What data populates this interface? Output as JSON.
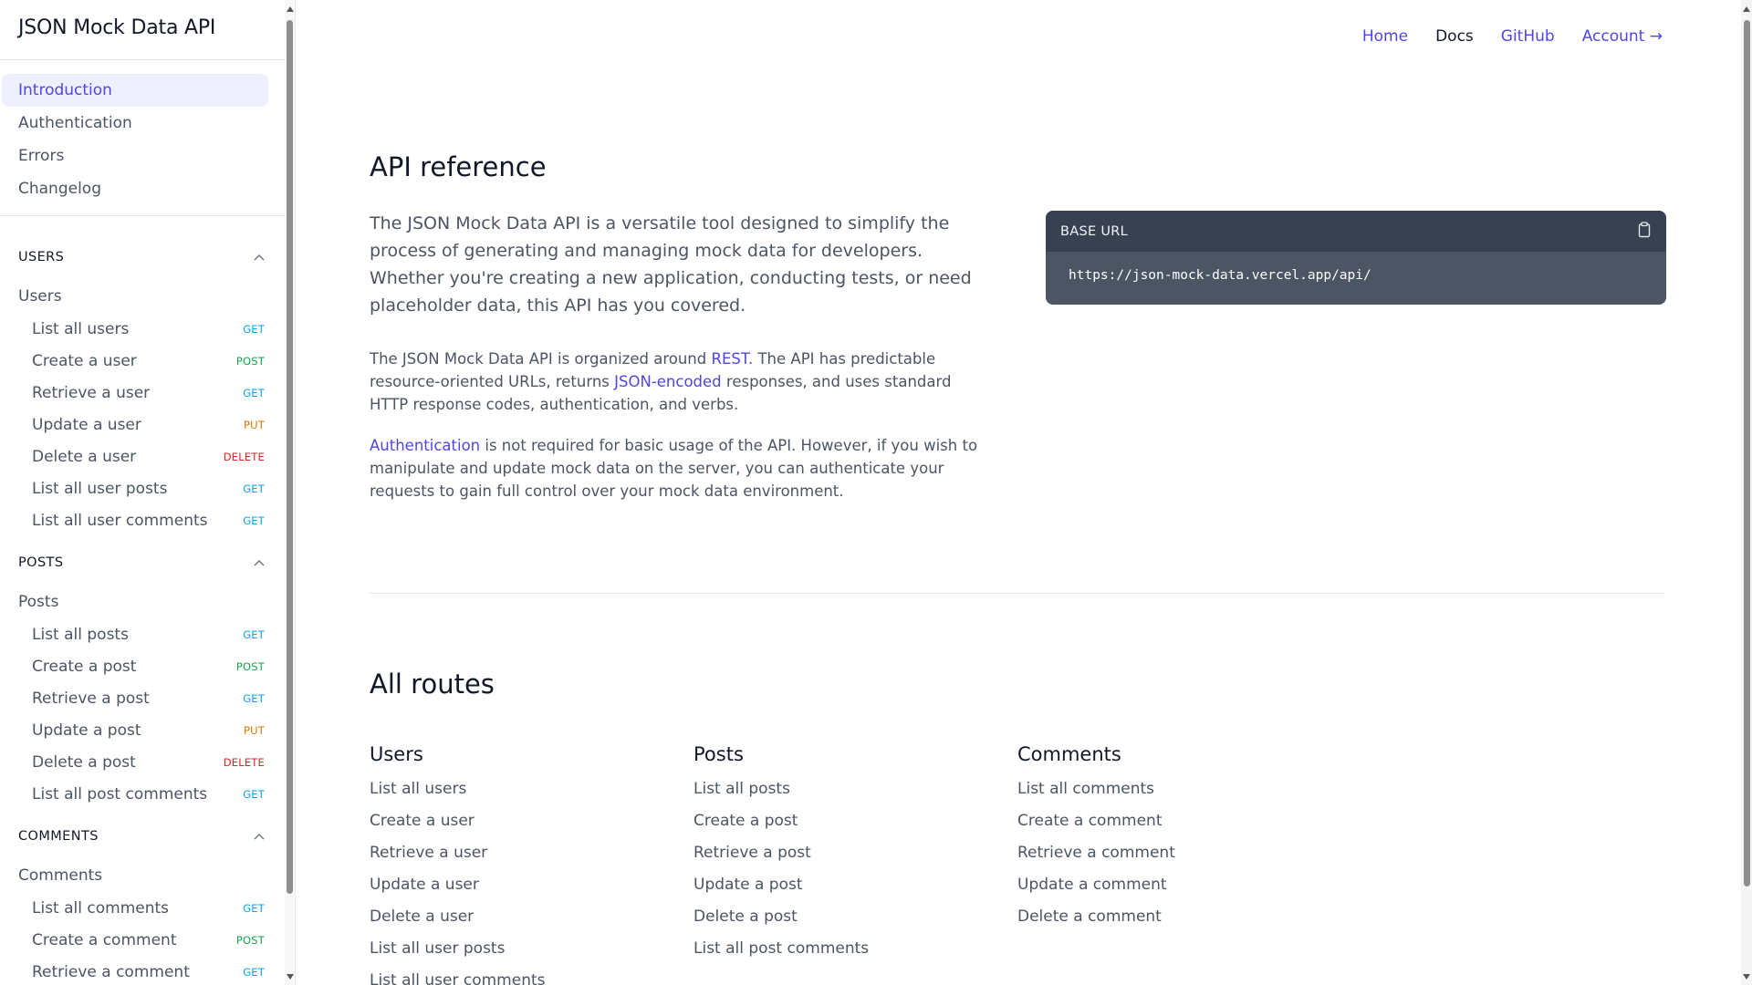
{
  "app": {
    "title": "JSON Mock Data API"
  },
  "topnav": {
    "home": "Home",
    "docs": "Docs",
    "github": "GitHub",
    "account": "Account →"
  },
  "sidebar": {
    "top_items": [
      {
        "label": "Introduction",
        "active": true
      },
      {
        "label": "Authentication"
      },
      {
        "label": "Errors"
      },
      {
        "label": "Changelog"
      }
    ],
    "sections": [
      {
        "title": "USERS",
        "group": "Users",
        "routes": [
          {
            "label": "List all users",
            "method": "GET"
          },
          {
            "label": "Create a user",
            "method": "POST"
          },
          {
            "label": "Retrieve a user",
            "method": "GET"
          },
          {
            "label": "Update a user",
            "method": "PUT"
          },
          {
            "label": "Delete a user",
            "method": "DELETE"
          },
          {
            "label": "List all user posts",
            "method": "GET"
          },
          {
            "label": "List all user comments",
            "method": "GET"
          }
        ]
      },
      {
        "title": "POSTS",
        "group": "Posts",
        "routes": [
          {
            "label": "List all posts",
            "method": "GET"
          },
          {
            "label": "Create a post",
            "method": "POST"
          },
          {
            "label": "Retrieve a post",
            "method": "GET"
          },
          {
            "label": "Update a post",
            "method": "PUT"
          },
          {
            "label": "Delete a post",
            "method": "DELETE"
          },
          {
            "label": "List all post comments",
            "method": "GET"
          }
        ]
      },
      {
        "title": "COMMENTS",
        "group": "Comments",
        "routes": [
          {
            "label": "List all comments",
            "method": "GET"
          },
          {
            "label": "Create a comment",
            "method": "POST"
          },
          {
            "label": "Retrieve a comment",
            "method": "GET"
          }
        ]
      }
    ]
  },
  "main": {
    "title": "API reference",
    "lead": "The JSON Mock Data API is a versatile tool designed to simplify the process of generating and managing mock data for developers. Whether you're creating a new application, conducting tests, or need placeholder data, this API has you covered.",
    "p1": {
      "before": "The JSON Mock Data API is organized around ",
      "link1": "REST",
      "middle": ". The API has predictable resource-oriented URLs, returns ",
      "link2": "JSON-encoded",
      "after": " responses, and uses standard HTTP response codes, authentication, and verbs."
    },
    "p2": {
      "link": "Authentication",
      "after": " is not required for basic usage of the API. However, if you wish to manipulate and update mock data on the server, you can authenticate your requests to gain full control over your mock data environment."
    },
    "base_url": {
      "label": "BASE URL",
      "value": "https://json-mock-data.vercel.app/api/",
      "icon": "clipboard-icon"
    },
    "all_routes_title": "All routes",
    "columns": [
      {
        "title": "Users",
        "routes": [
          "List all users",
          "Create a user",
          "Retrieve a user",
          "Update a user",
          "Delete a user",
          "List all user posts",
          "List all user comments"
        ]
      },
      {
        "title": "Posts",
        "routes": [
          "List all posts",
          "Create a post",
          "Retrieve a post",
          "Update a post",
          "Delete a post",
          "List all post comments"
        ]
      },
      {
        "title": "Comments",
        "routes": [
          "List all comments",
          "Create a comment",
          "Retrieve a comment",
          "Update a comment",
          "Delete a comment"
        ]
      }
    ]
  },
  "colors": {
    "accent": "#4f46e5",
    "get": "#0ea5e9",
    "post": "#16a34a",
    "put": "#d97706",
    "delete": "#dc2626"
  }
}
